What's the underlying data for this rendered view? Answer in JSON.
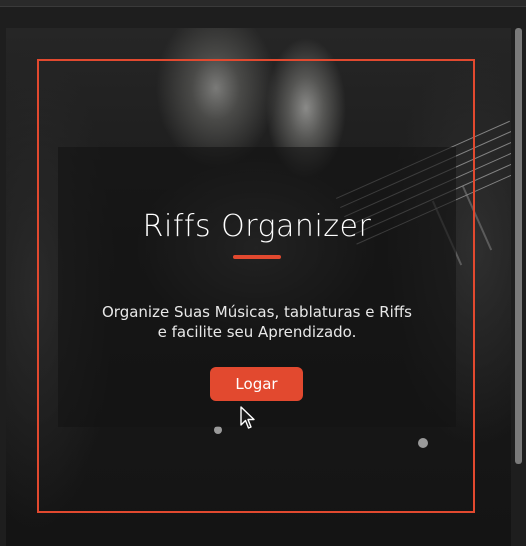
{
  "app": {
    "title": "Riffs Organizer",
    "subtitle_line1": "Organize Suas Músicas, tablaturas e Riffs",
    "subtitle_line2": "e facilite seu Aprendizado.",
    "login_label": "Logar"
  },
  "colors": {
    "accent": "#e2492f",
    "text": "#ffffff",
    "overlay": "rgba(20,20,20,0.62)"
  },
  "icons": {
    "cursor": "mouse-pointer-icon"
  }
}
